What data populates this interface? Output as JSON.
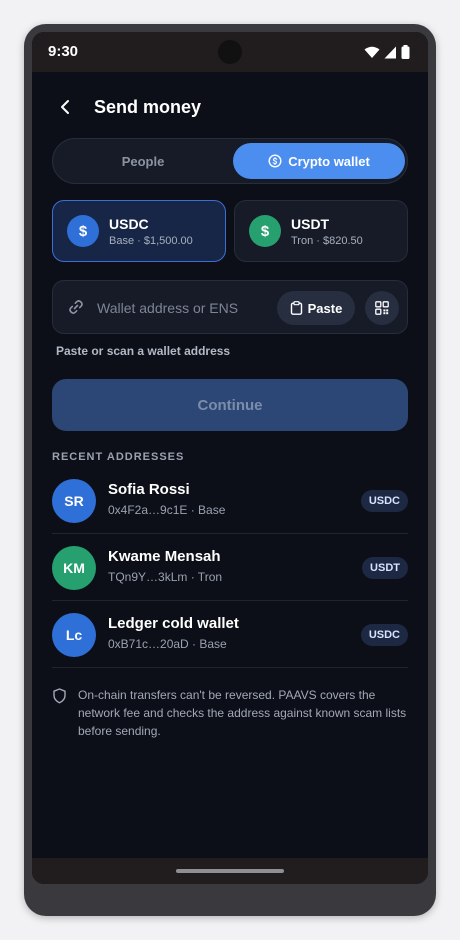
{
  "status_bar": {
    "time": "9:30",
    "icons": [
      "wifi-icon",
      "signal-icon",
      "battery-icon"
    ]
  },
  "header": {
    "title": "Send money",
    "back_icon": "back-arrow-icon"
  },
  "segmented": {
    "tabs": [
      {
        "label": "People",
        "selected": false
      },
      {
        "label": "Crypto wallet",
        "selected": true,
        "icon": "coin-icon"
      }
    ]
  },
  "tokens": [
    {
      "symbol": "USDC",
      "subtitle": "Base · $1,500.00",
      "selected": true,
      "icon_glyph": "$",
      "color": "#2f6fd8"
    },
    {
      "symbol": "USDT",
      "subtitle": "Tron · $820.50",
      "selected": false,
      "icon_glyph": "$",
      "color": "#27a070"
    }
  ],
  "address_field": {
    "placeholder": "Wallet address or ENS",
    "value": "",
    "paste_label": "Paste",
    "helper": "Paste or scan a wallet address"
  },
  "continue_label": "Continue",
  "recent": {
    "title": "RECENT ADDRESSES",
    "items": [
      {
        "initials": "SR",
        "name": "Sofia Rossi",
        "address": "0x4F2a…9c1E · Base",
        "token": "USDC",
        "color": "#2f6fd8"
      },
      {
        "initials": "KM",
        "name": "Kwame Mensah",
        "address": "TQn9Y…3kLm · Tron",
        "token": "USDT",
        "color": "#27a070"
      },
      {
        "initials": "Lc",
        "name": "Ledger cold wallet",
        "address": "0xB71c…20aD · Base",
        "token": "USDC",
        "color": "#2f6fd8"
      }
    ]
  },
  "notice": "On-chain transfers can't be reversed. PAAVS covers the network fee and checks the address against known scam lists before sending.",
  "colors": {
    "accent": "#4b8ef0",
    "background": "#0c0f17",
    "usdc": "#2f6fd8",
    "usdt": "#27a070"
  }
}
